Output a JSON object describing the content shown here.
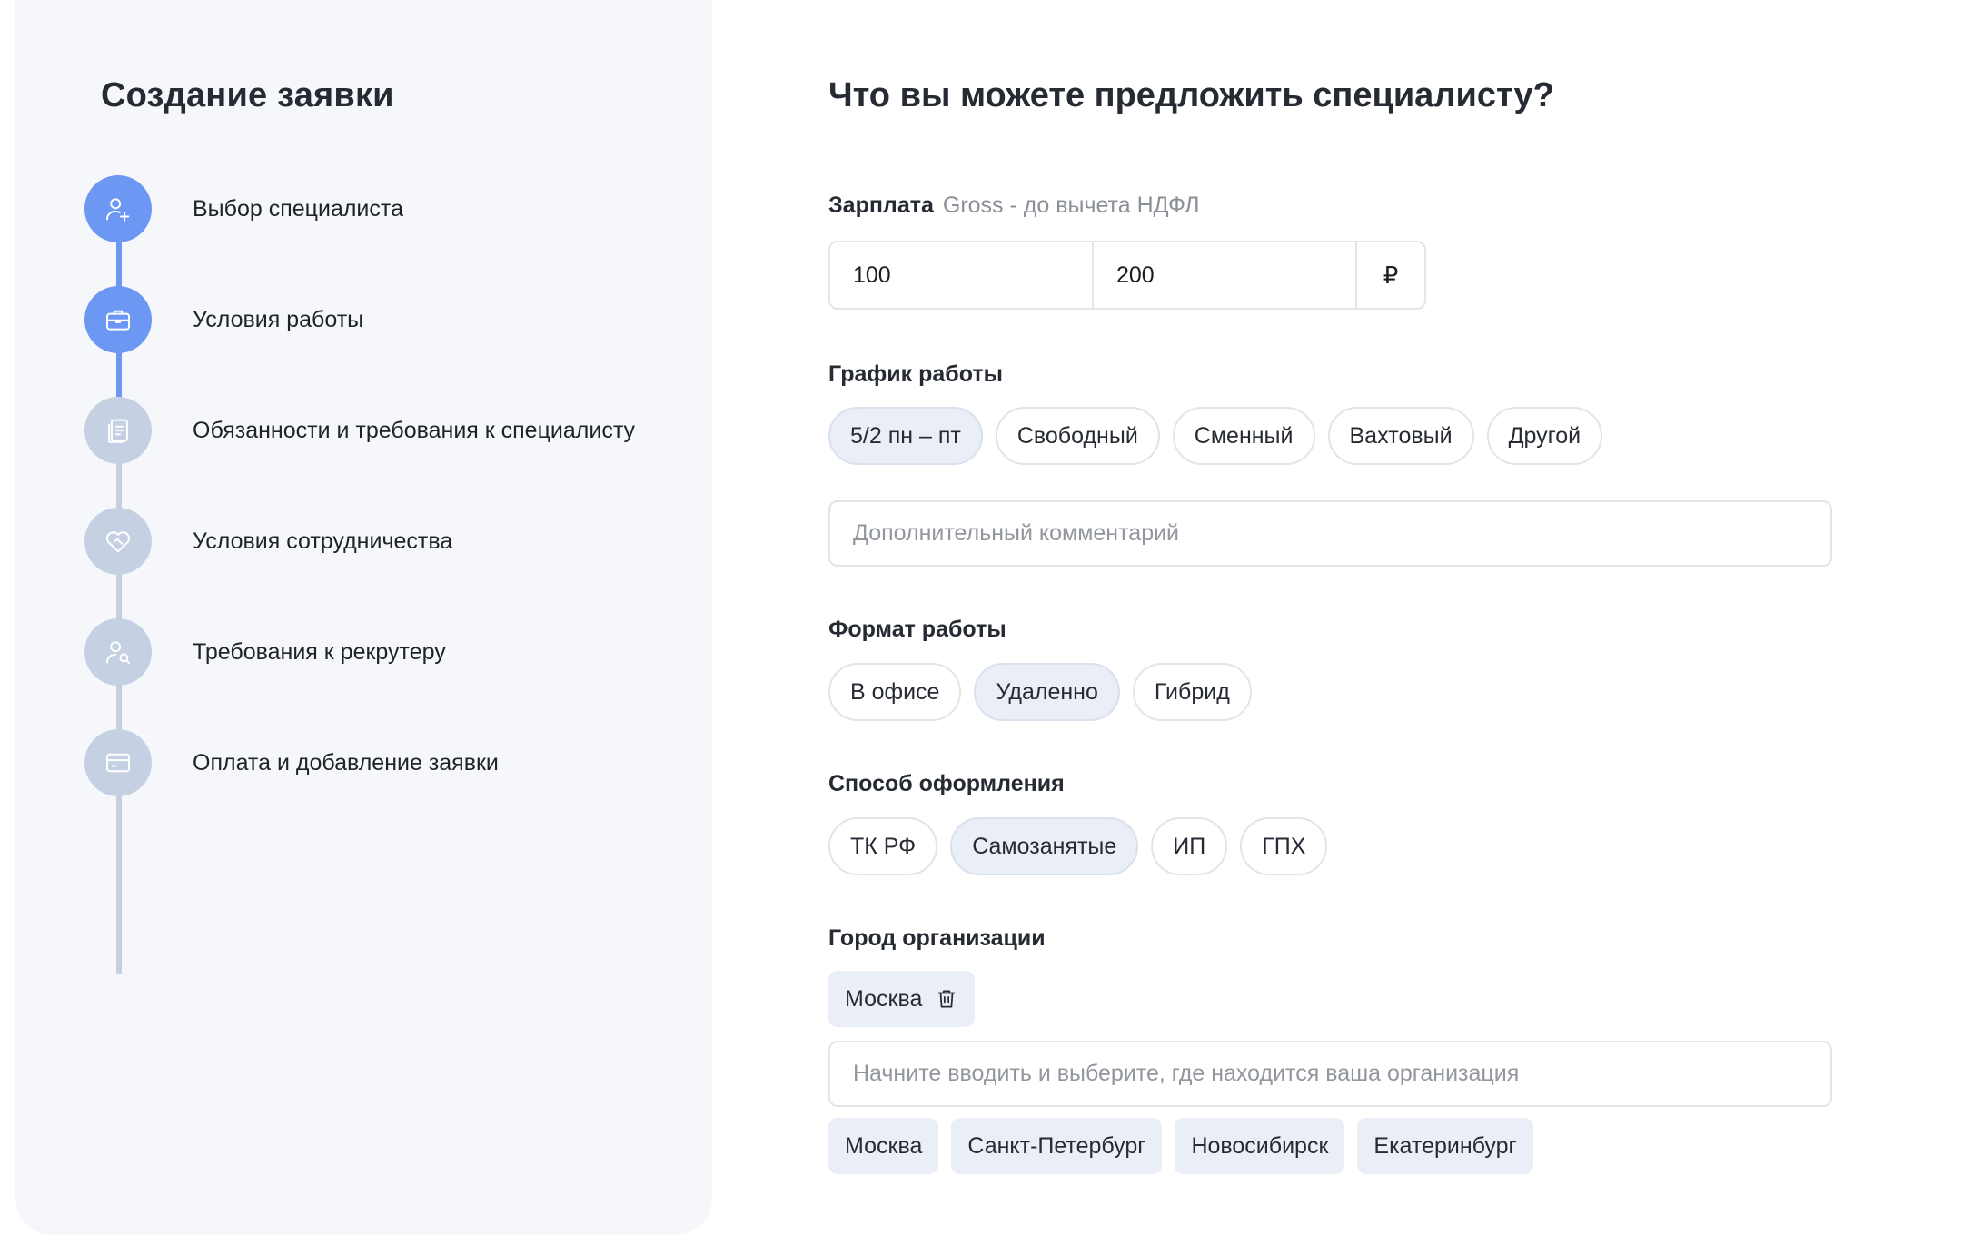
{
  "sidebar": {
    "title": "Создание заявки",
    "steps": [
      {
        "label": "Выбор специалиста",
        "icon": "user-plus-icon",
        "state": "active"
      },
      {
        "label": "Условия работы",
        "icon": "briefcase-icon",
        "state": "active"
      },
      {
        "label": "Обязанности и требования к специалисту",
        "icon": "clipboard-icon",
        "state": "inactive"
      },
      {
        "label": "Условия сотрудничества",
        "icon": "handshake-heart-icon",
        "state": "inactive"
      },
      {
        "label": "Требования к рекрутеру",
        "icon": "user-search-icon",
        "state": "inactive"
      },
      {
        "label": "Оплата и добавление заявки",
        "icon": "card-icon",
        "state": "inactive"
      }
    ]
  },
  "main": {
    "title": "Что вы можете предложить специалисту?",
    "salary": {
      "label": "Зарплата",
      "hint": "Gross - до вычета НДФЛ",
      "from": "100",
      "to": "200",
      "currency": "₽"
    },
    "schedule": {
      "label": "График работы",
      "options": [
        "5/2 пн – пт",
        "Свободный",
        "Сменный",
        "Вахтовый",
        "Другой"
      ],
      "selected": "5/2 пн – пт",
      "comment_placeholder": "Дополнительный комментарий"
    },
    "format": {
      "label": "Формат работы",
      "options": [
        "В офисе",
        "Удаленно",
        "Гибрид"
      ],
      "selected": "Удаленно"
    },
    "registration": {
      "label": "Способ оформления",
      "options": [
        "ТК РФ",
        "Самозанятые",
        "ИП",
        "ГПХ"
      ],
      "selected": "Самозанятые"
    },
    "city": {
      "label": "Город организации",
      "selected_city": "Москва",
      "input_placeholder": "Начните вводить и выберите, где находится ваша организация",
      "suggestions": [
        "Москва",
        "Санкт-Петербург",
        "Новосибирск",
        "Екатеринбург"
      ]
    }
  },
  "colors": {
    "active_step": "#6c97f2",
    "inactive_step": "#c5d1e3",
    "chip_selected_bg": "#e9eef7",
    "sidebar_bg": "#f6f7fa"
  }
}
